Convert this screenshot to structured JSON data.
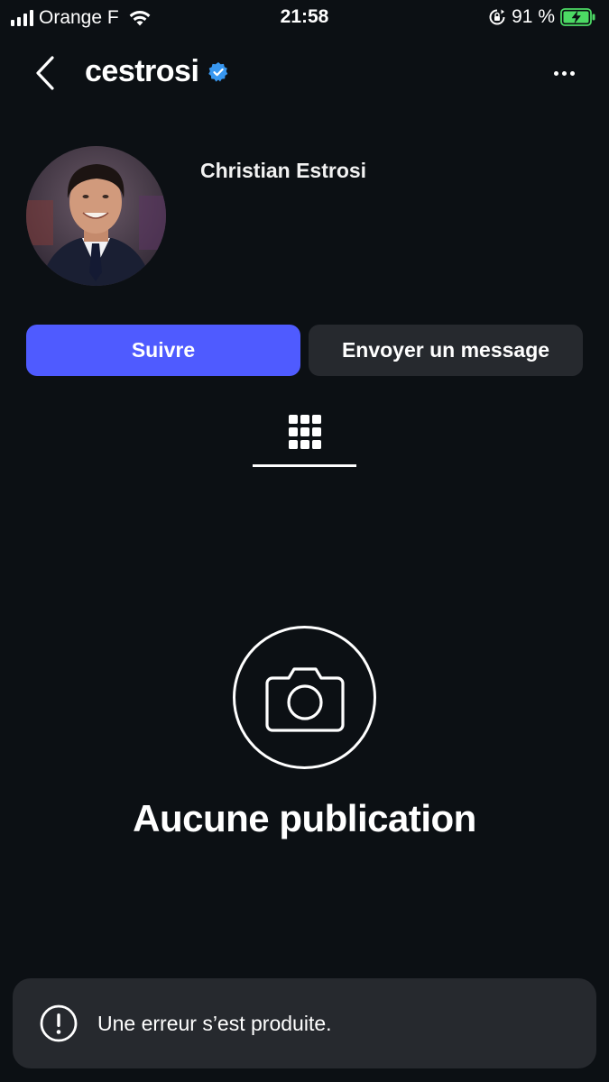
{
  "status_bar": {
    "carrier": "Orange F",
    "time": "21:58",
    "battery": "91 %"
  },
  "header": {
    "username": "cestrosi"
  },
  "profile": {
    "full_name": "Christian Estrosi"
  },
  "actions": {
    "follow_label": "Suivre",
    "message_label": "Envoyer un message"
  },
  "empty_state": {
    "title": "Aucune publication"
  },
  "toast": {
    "message": "Une erreur s’est produite."
  },
  "colors": {
    "background": "#0c1014",
    "follow_button": "#4f5bff",
    "secondary_button": "#26292e",
    "verified_badge": "#3897f0",
    "battery_fill": "#4cd964"
  },
  "icons": [
    "back-chevron-icon",
    "verified-badge-icon",
    "more-options-icon",
    "grid-icon",
    "camera-icon",
    "alert-icon",
    "signal-icon",
    "wifi-icon",
    "rotation-lock-icon",
    "battery-icon"
  ]
}
